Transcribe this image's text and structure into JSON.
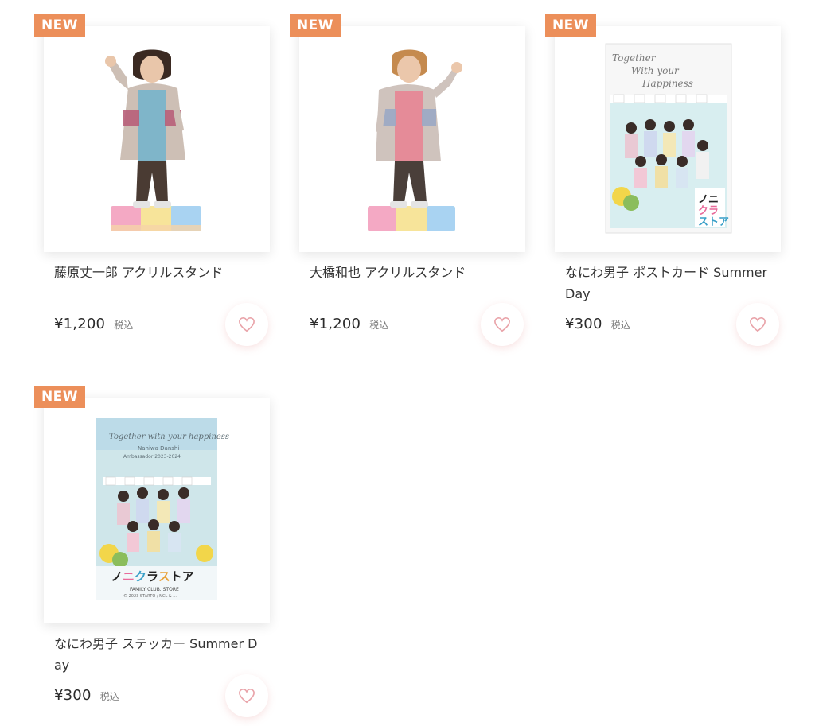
{
  "products": [
    {
      "badge": "NEW",
      "name": "藤原丈一郎 アクリルスタンド",
      "price": "¥1,200",
      "tax": "税込",
      "image": "acrylic-stand-figure"
    },
    {
      "badge": "NEW",
      "name": "大橋和也 アクリルスタンド",
      "price": "¥1,200",
      "tax": "税込",
      "image": "acrylic-stand-figure"
    },
    {
      "badge": "NEW",
      "name": "なにわ男子 ポストカード Summer Day",
      "price": "¥300",
      "tax": "税込",
      "image": "postcard-group-photo"
    },
    {
      "badge": "NEW",
      "name": "なにわ男子 ステッカー Summer Day",
      "price": "¥300",
      "tax": "税込",
      "image": "sticker-group-photo"
    }
  ],
  "artwork": {
    "postcard_script": "Together With your Happiness",
    "postcard_logo": "ノニクラストア",
    "sticker_script": "Together with your happiness",
    "sticker_subtitle": "Naniwa Danshi",
    "sticker_subtitle2": "Ambassador 2023-2024",
    "sticker_logo": "ノニクラストア",
    "sticker_footer": "FAMILY CLUB. STORE",
    "sticker_copyright": "© 2023 STARTO / NCL & ..."
  },
  "colors": {
    "badge": "#ec8f5a",
    "heart": "#e9a3a9",
    "text": "#2b2b2b"
  }
}
